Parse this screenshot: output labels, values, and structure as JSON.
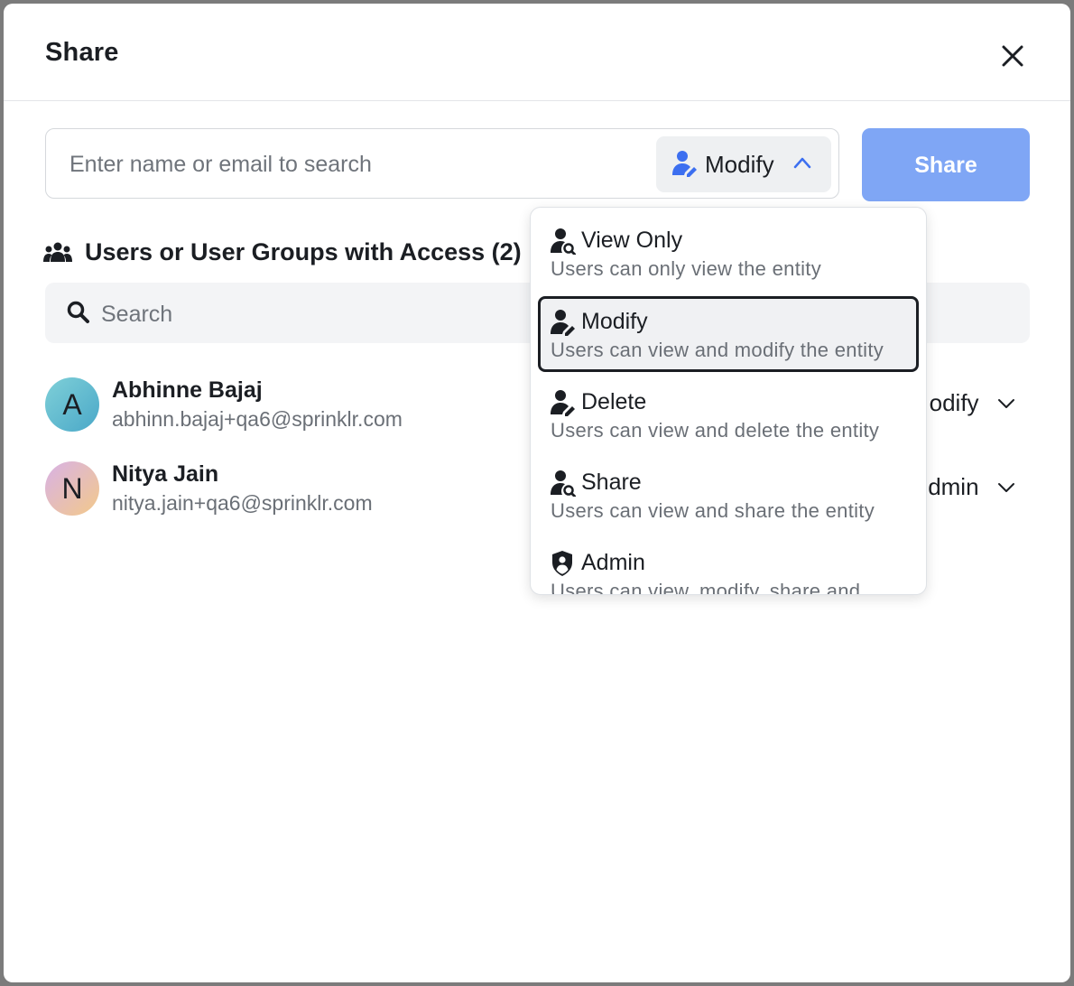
{
  "dialog": {
    "title": "Share",
    "close_icon": "close-icon"
  },
  "invite": {
    "search_placeholder": "Enter name or email to search",
    "search_value": "",
    "permission_selected": "Modify",
    "permission_icon": "user-edit-icon",
    "permission_chevron": "chevron-up-icon",
    "share_button": "Share",
    "share_button_color": "#7fa6f5"
  },
  "access": {
    "heading": "Users or User Groups with Access (2)",
    "heading_icon": "user-group-icon",
    "search_placeholder": "Search",
    "search_icon": "search-icon",
    "users": [
      {
        "initial": "A",
        "name": "Abhinne Bajaj",
        "email": "abhinn.bajaj+qa6@sprinklr.com",
        "permission": "odify"
      },
      {
        "initial": "N",
        "name": "Nitya Jain",
        "email": "nitya.jain+qa6@sprinklr.com",
        "permission": "dmin"
      }
    ]
  },
  "dropdown": {
    "options": [
      {
        "label": "View Only",
        "description": "Users can only view the entity",
        "icon": "user-view-icon",
        "selected": false
      },
      {
        "label": "Modify",
        "description": "Users can view and modify the entity",
        "icon": "user-edit-icon",
        "selected": true
      },
      {
        "label": "Delete",
        "description": "Users can view and delete the entity",
        "icon": "user-delete-icon",
        "selected": false
      },
      {
        "label": "Share",
        "description": "Users can view and share the entity",
        "icon": "user-share-icon",
        "selected": false
      },
      {
        "label": "Admin",
        "description": "Users can view, modify, share and",
        "icon": "shield-user-icon",
        "selected": false
      }
    ]
  },
  "colors": {
    "accent_blue": "#3c6ff0",
    "text_primary": "#1b1e23",
    "text_secondary": "#6a6f76"
  }
}
